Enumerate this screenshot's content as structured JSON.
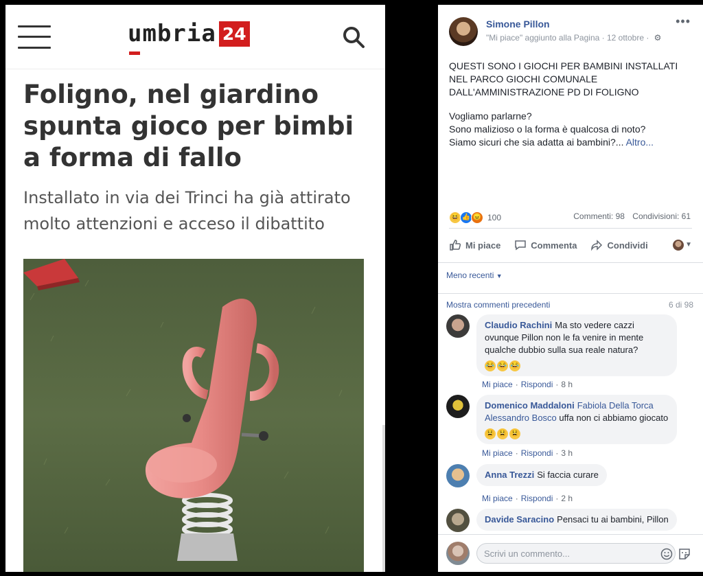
{
  "article": {
    "logo_text": "umbria",
    "logo_number": "24",
    "headline": "Foligno, nel giardino spunta gioco per bimbi a forma di fallo",
    "subtitle": "Installato in via dei Trinci ha già attirato molto attenzioni e acceso il dibattito"
  },
  "post": {
    "author": "Simone Pillon",
    "meta": "\"Mi piace\" aggiunto alla Pagina · 12 ottobre ·",
    "menu": "•••",
    "paragraphs": [
      "QUESTI SONO I GIOCHI PER BAMBINI INSTALLATI NEL PARCO GIOCHI COMUNALE DALL'AMMINISTRAZIONE PD DI FOLIGNO",
      "Vogliamo parlarne?\nSono malizioso o la forma è qualcosa di noto?\nSiamo sicuri che sia adatta ai bambini?..."
    ],
    "more": "Altro...",
    "reaction_count": "100",
    "comments_count": "Commenti: 98",
    "shares_count": "Condivisioni: 61",
    "actions": {
      "like": "Mi piace",
      "comment": "Commenta",
      "share": "Condividi"
    },
    "sort_label": "Meno recenti",
    "show_previous": "Mostra commenti precedenti",
    "page_count": "6 di 98"
  },
  "comments": [
    {
      "name": "Claudio Rachini",
      "text": "Ma sto vedere cazzi ovunque Pillon non le fa venire in mente qualche dubbio sulla sua reale natura?",
      "like": "Mi piace",
      "reply": "Rispondi",
      "time": "8 h"
    },
    {
      "name": "Domenico Maddaloni",
      "tag1": "Fabiola Della Torca",
      "tag2": "Alessandro Bosco",
      "text": "uffa non ci abbiamo giocato",
      "like": "Mi piace",
      "reply": "Rispondi",
      "time": "3 h"
    },
    {
      "name": "Anna Trezzi",
      "text": "Si faccia curare",
      "like": "Mi piace",
      "reply": "Rispondi",
      "time": "2 h"
    },
    {
      "name": "Davide Saracino",
      "text": "Pensaci tu ai bambini, Pillon"
    }
  ],
  "composer": {
    "placeholder": "Scrivi un commento..."
  },
  "colors": {
    "brand_red": "#d21e1e",
    "fb_link": "#385898"
  }
}
